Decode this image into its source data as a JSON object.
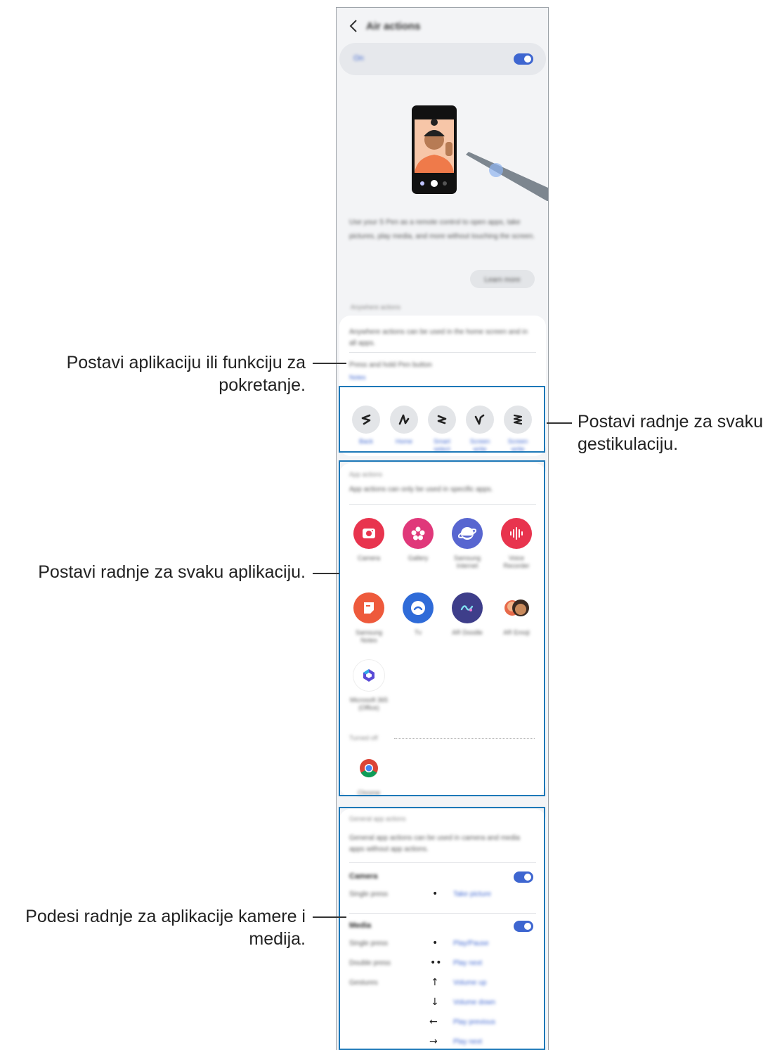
{
  "screen": {
    "title": "Air actions",
    "master_toggle_label": "On",
    "master_toggle_on": true,
    "description": "Use your S Pen as a remote control to open apps, take pictures, play media, and more without touching the screen.",
    "learn_more_button": "Learn more",
    "anywhere_section_header": "Anywhere actions",
    "anywhere_description": "Anywhere actions can be used in the home screen and in all apps.",
    "press_hold_title": "Press and hold Pen button",
    "press_hold_value": "Notes",
    "gestures": [
      {
        "icon": "swipe-back-gesture-icon",
        "label": "Back"
      },
      {
        "icon": "recent-apps-gesture-icon",
        "label": "Home"
      },
      {
        "icon": "smart-select-gesture-icon",
        "label": "Smart select"
      },
      {
        "icon": "screen-write-gesture-icon",
        "label": "Screen write"
      },
      {
        "icon": "zigzag-gesture-icon",
        "label": "Screen write"
      }
    ],
    "app_actions_header": "App actions",
    "app_actions_description": "App actions can only be used in specific apps.",
    "apps": [
      {
        "icon": "camera-app-icon",
        "label": "Camera",
        "color": "#e8344e"
      },
      {
        "icon": "gallery-app-icon",
        "label": "Gallery",
        "color": "#e0387a"
      },
      {
        "icon": "internet-app-icon",
        "label": "Samsung Internet",
        "color": "#5866d0"
      },
      {
        "icon": "voice-recorder-app-icon",
        "label": "Voice Recorder",
        "color": "#e8344e"
      },
      {
        "icon": "samsung-notes-app-icon",
        "label": "Samsung Notes",
        "color": "#ee5a3c"
      },
      {
        "icon": "tv-app-icon",
        "label": "Tv",
        "color": "#2f6bd8"
      },
      {
        "icon": "ar-doodle-app-icon",
        "label": "AR Doodle",
        "color": "#3e3e8a"
      },
      {
        "icon": "ar-emoji-app-icon",
        "label": "AR Emoji",
        "color": "#e76a4a"
      },
      {
        "icon": "microsoft-office-app-icon",
        "label": "Microsoft 365 (Office)",
        "color": "#5a4bd6"
      }
    ],
    "turned_off_header": "Turned off",
    "turned_off_apps": [
      {
        "icon": "chrome-app-icon",
        "label": "Chrome"
      }
    ],
    "general_section_header": "General app actions",
    "general_description": "General app actions can be used in camera and media apps without app actions.",
    "camera": {
      "title": "Camera",
      "toggle_on": true,
      "rows": [
        {
          "label": "Single press",
          "symbol": "•",
          "value": "Take picture"
        }
      ]
    },
    "media": {
      "title": "Media",
      "toggle_on": true,
      "rows": [
        {
          "label": "Single press",
          "symbol": "•",
          "value": "Play/Pause"
        },
        {
          "label": "Double press",
          "symbol": "••",
          "value": "Play next"
        },
        {
          "label": "Gestures",
          "symbol": "↑",
          "value": "Volume up"
        },
        {
          "label": "",
          "symbol": "↓",
          "value": "Volume down"
        },
        {
          "label": "",
          "symbol": "←",
          "value": "Play previous"
        },
        {
          "label": "",
          "symbol": "→",
          "value": "Play next"
        }
      ]
    }
  },
  "callouts": {
    "launch": "Postavi aplikaciju ili funkciju za pokretanje.",
    "gesture": "Postavi radnje za svaku gestikulaciju.",
    "app": "Postavi radnje za svaku aplikaciju.",
    "media": "Podesi radnje za aplikacije kamere i medija."
  },
  "colors": {
    "accent": "#3e66d0",
    "frame": "#1d78b8",
    "background": "#f3f4f6"
  }
}
